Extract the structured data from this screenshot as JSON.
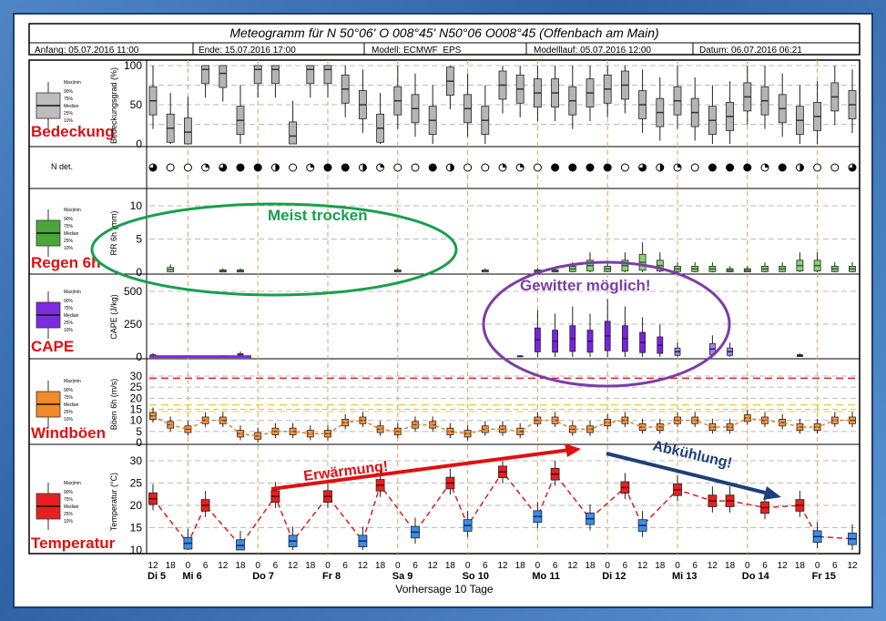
{
  "header": {
    "title": "Meteogramm für N 50°06' O 008°45' N50°06 O008°45 (Offenbach am Main)",
    "anfang": "Anfang: 05.07.2016 11:00",
    "ende": "Ende: 15.07.2016 17:00",
    "modell": "Modell: ECMWF_EPS",
    "modelllauf": "Modelllauf: 05.07.2016 12:00",
    "datum": "Datum: 06.07.2016 06:21"
  },
  "footer": {
    "xlabel": "Vorhersage 10 Tage"
  },
  "legend_labels": {
    "max": "Max|min",
    "p90": "90%",
    "p75": "75%",
    "median": "Median",
    "p25": "25%",
    "p10": "10%"
  },
  "panels": {
    "bedeckung": {
      "name": "Bedeckung",
      "ylabel": "Bedeckungsgrad (%)",
      "color": "#a9a9a9",
      "ticks": [
        "0",
        "50",
        "100"
      ]
    },
    "ndet": {
      "label": "N det."
    },
    "regen": {
      "name": "Regen 6h",
      "ylabel": "RR 6h (mm)",
      "color": "#6fbf5a",
      "ticks": [
        "0",
        "5",
        "10"
      ]
    },
    "cape": {
      "name": "CAPE",
      "ylabel": "CAPE (J/kg)",
      "color": "#7b2be0",
      "ticks": [
        "0",
        "250",
        "500"
      ]
    },
    "wind": {
      "name": "Windböen",
      "ylabel": "Böen 6h (m/s)",
      "color": "#f08a2a",
      "ticks": [
        "0",
        "5",
        "10",
        "15",
        "20",
        "25",
        "30"
      ]
    },
    "temp": {
      "name": "Temperatur",
      "ylabel": "Temperatur (°C)",
      "color": "#e52020",
      "ticks": [
        "10",
        "15",
        "20",
        "25",
        "30"
      ]
    }
  },
  "annotations": {
    "trocken": "Meist trocken",
    "gewitter": "Gewitter möglich!",
    "erwaermung": "Erwärmung!",
    "abkuehlung": "Abkühlung!"
  },
  "chart_data": {
    "type": "box",
    "x_hours": [
      "12",
      "18",
      "0",
      "6",
      "12",
      "18",
      "0",
      "6",
      "12",
      "18",
      "0",
      "6",
      "12",
      "18",
      "0",
      "6",
      "12",
      "18",
      "0",
      "6",
      "12",
      "18",
      "0",
      "6",
      "12",
      "18",
      "0",
      "6",
      "12",
      "18",
      "0",
      "6",
      "12",
      "18",
      "0",
      "6",
      "12",
      "18",
      "0",
      "6",
      "12"
    ],
    "day_labels": [
      "Di 5",
      "Mi 6",
      "Do 7",
      "Fr 8",
      "Sa 9",
      "So 10",
      "Mo 11",
      "Di 12",
      "Mi 13",
      "Do 14",
      "Fr 15"
    ],
    "bedeckung_median": [
      55,
      20,
      15,
      95,
      90,
      30,
      95,
      95,
      10,
      95,
      95,
      70,
      50,
      20,
      55,
      45,
      30,
      80,
      45,
      30,
      75,
      70,
      65,
      65,
      55,
      65,
      70,
      75,
      50,
      40,
      55,
      40,
      30,
      35,
      60,
      55,
      45,
      30,
      35,
      60,
      50
    ],
    "ndet_symbols": [
      3,
      0,
      0,
      1,
      3,
      4,
      4,
      2,
      0,
      1,
      4,
      4,
      2,
      1,
      0,
      0,
      4,
      2,
      0,
      0,
      1,
      1,
      0,
      4,
      4,
      4,
      4,
      0,
      3,
      2,
      1,
      0,
      4,
      4,
      4,
      1,
      4,
      2,
      0,
      0,
      3
    ],
    "regen_median": [
      0,
      0.4,
      0,
      0,
      0.2,
      0.2,
      0,
      0,
      0,
      0,
      0,
      0,
      0,
      0,
      0.2,
      0,
      0,
      0,
      0,
      0.2,
      0,
      0,
      0.2,
      0.2,
      0.5,
      1,
      0.5,
      1,
      1.5,
      1,
      0.5,
      0.5,
      0.5,
      0.3,
      0.3,
      0.5,
      0.5,
      1,
      1,
      0.5,
      0.5
    ],
    "cape_median": [
      10,
      0,
      5,
      0,
      5,
      15,
      0,
      0,
      0,
      0,
      0,
      0,
      0,
      0,
      0,
      0,
      0,
      0,
      0,
      0,
      0,
      5,
      130,
      120,
      140,
      120,
      160,
      140,
      110,
      90,
      40,
      0,
      60,
      40,
      0,
      0,
      0,
      10,
      0,
      0,
      0
    ],
    "wind_median": [
      12,
      8,
      6,
      10,
      10,
      4,
      3,
      5,
      5,
      4,
      4,
      9,
      10,
      6,
      5,
      8,
      8,
      5,
      4,
      6,
      6,
      5,
      10,
      10,
      6,
      6,
      9,
      10,
      7,
      7,
      10,
      10,
      7,
      7,
      11,
      10,
      9,
      7,
      7,
      10,
      10
    ],
    "temp_median": [
      21.5,
      11.5,
      20,
      11,
      22,
      12,
      22,
      12,
      24.5,
      14,
      25,
      15.5,
      27.5,
      17.5,
      27,
      17,
      24,
      15.5,
      23.5,
      21,
      21,
      19.5,
      20,
      13,
      12.5
    ],
    "wind_ylim": [
      0,
      30
    ],
    "temp_ylim": [
      10,
      30
    ]
  }
}
